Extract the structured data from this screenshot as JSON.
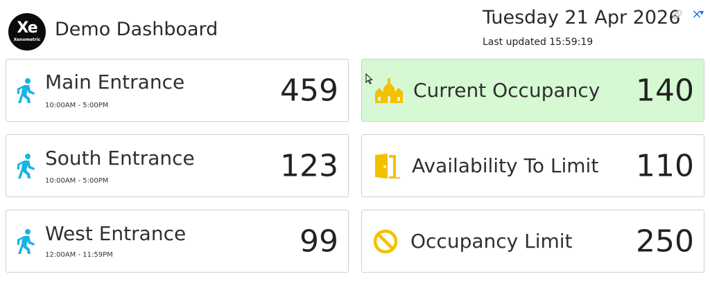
{
  "header": {
    "logo_text": "Xe",
    "logo_subtext": "Xenometric",
    "title": "Demo Dashboard",
    "date": "Tuesday 21 Apr 2026",
    "last_updated": "Last updated 15:59:19",
    "link_icon": "link-icon",
    "close_icon": "close-icon",
    "close_glyph": "×"
  },
  "entrances": [
    {
      "title": "Main Entrance",
      "hours": "10:00AM - 5:00PM",
      "value": "459",
      "icon": "walking-person-icon"
    },
    {
      "title": "South Entrance",
      "hours": "10:00AM - 5:00PM",
      "value": "123",
      "icon": "walking-person-icon"
    },
    {
      "title": "West Entrance",
      "hours": "12:00AM - 11:59PM",
      "value": "99",
      "icon": "walking-person-icon"
    }
  ],
  "stats": [
    {
      "title": "Current Occupancy",
      "value": "140",
      "icon": "building-icon",
      "highlight": true
    },
    {
      "title": "Availability To Limit",
      "value": "110",
      "icon": "door-icon",
      "highlight": false
    },
    {
      "title": "Occupancy Limit",
      "value": "250",
      "icon": "prohibited-icon",
      "highlight": false
    }
  ],
  "colors": {
    "entrance_icon": "#1ab3e6",
    "stat_icon": "#f5c000",
    "highlight_bg": "#d6f8d3",
    "accent": "#1a73e8"
  }
}
